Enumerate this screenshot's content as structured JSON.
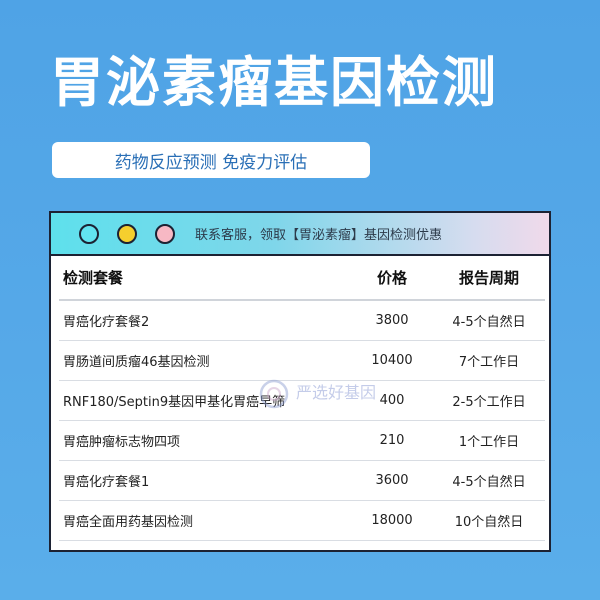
{
  "header": {
    "title": "胃泌素瘤基因检测",
    "subtitle": "药物反应预测 免疫力评估"
  },
  "window": {
    "notice": "联系客服，领取【胃泌素瘤】基因检测优惠"
  },
  "table": {
    "headers": [
      "检测套餐",
      "价格",
      "报告周期"
    ],
    "rows": [
      [
        "胃癌化疗套餐2",
        "3800",
        "4-5个自然日"
      ],
      [
        "胃肠道间质瘤46基因检测",
        "10400",
        "7个工作日"
      ],
      [
        "RNF180/Septin9基因甲基化胃癌早筛",
        "400",
        "2-5个工作日"
      ],
      [
        "胃癌肿瘤标志物四项",
        "210",
        "1个工作日"
      ],
      [
        "胃癌化疗套餐1",
        "3600",
        "4-5个自然日"
      ],
      [
        "胃癌全面用药基因检测",
        "18000",
        "10个自然日"
      ]
    ]
  },
  "watermark": {
    "text": "严选好基因"
  },
  "colors": {
    "background": "#4fa3e6",
    "border": "#1c2233",
    "dot_cyan": "#62e4f0",
    "dot_yellow": "#f5cf2e",
    "dot_pink": "#f7b8c4"
  }
}
